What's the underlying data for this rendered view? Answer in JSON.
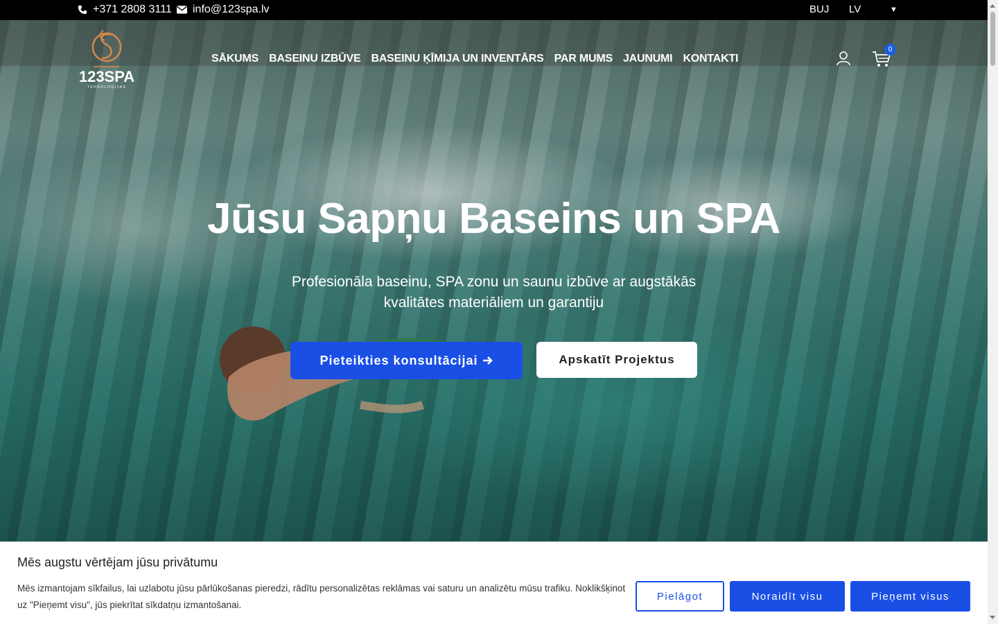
{
  "topbar": {
    "phone": "+371 2808 3111",
    "email": "info@123spa.lv",
    "lang_buj": "BUJ",
    "lang_lv": "LV"
  },
  "brand": {
    "name": "123SPA",
    "tagline": "TEHNOLOĢIJAS"
  },
  "nav": {
    "items": [
      {
        "label": "SĀKUMS"
      },
      {
        "label": "BASEINU IZBŪVE"
      },
      {
        "label": "BASEINU ĶĪMIJA UN INVENTĀRS"
      },
      {
        "label": "PAR MUMS"
      },
      {
        "label": "JAUNUMI"
      },
      {
        "label": "KONTAKTI"
      }
    ],
    "cart_count": "0"
  },
  "hero": {
    "title": "Jūsu Sapņu Baseins un SPA",
    "subtitle": "Profesionāla baseinu, SPA zonu un saunu izbūve ar augstākās kvalitātes materiāliem un garantiju",
    "cta_primary": "Pieteikties konsultācijai",
    "cta_secondary": "Apskatīt Projektus"
  },
  "cookie": {
    "title": "Mēs augstu vērtējam jūsu privātumu",
    "text": "Mēs izmantojam sīkfailus, lai uzlabotu jūsu pārlūkošanas pieredzi, rādītu personalizētas reklāmas vai saturu un analizētu mūsu trafiku. Noklikšķinot uz \"Pieņemt visu\", jūs piekrītat sīkdatņu izmantošanai.",
    "customize": "Pielāgot",
    "reject": "Noraidīt visu",
    "accept": "Pieņemt visus"
  },
  "colors": {
    "accent": "#1a4fe6",
    "logo_gold": "#d4894a"
  }
}
